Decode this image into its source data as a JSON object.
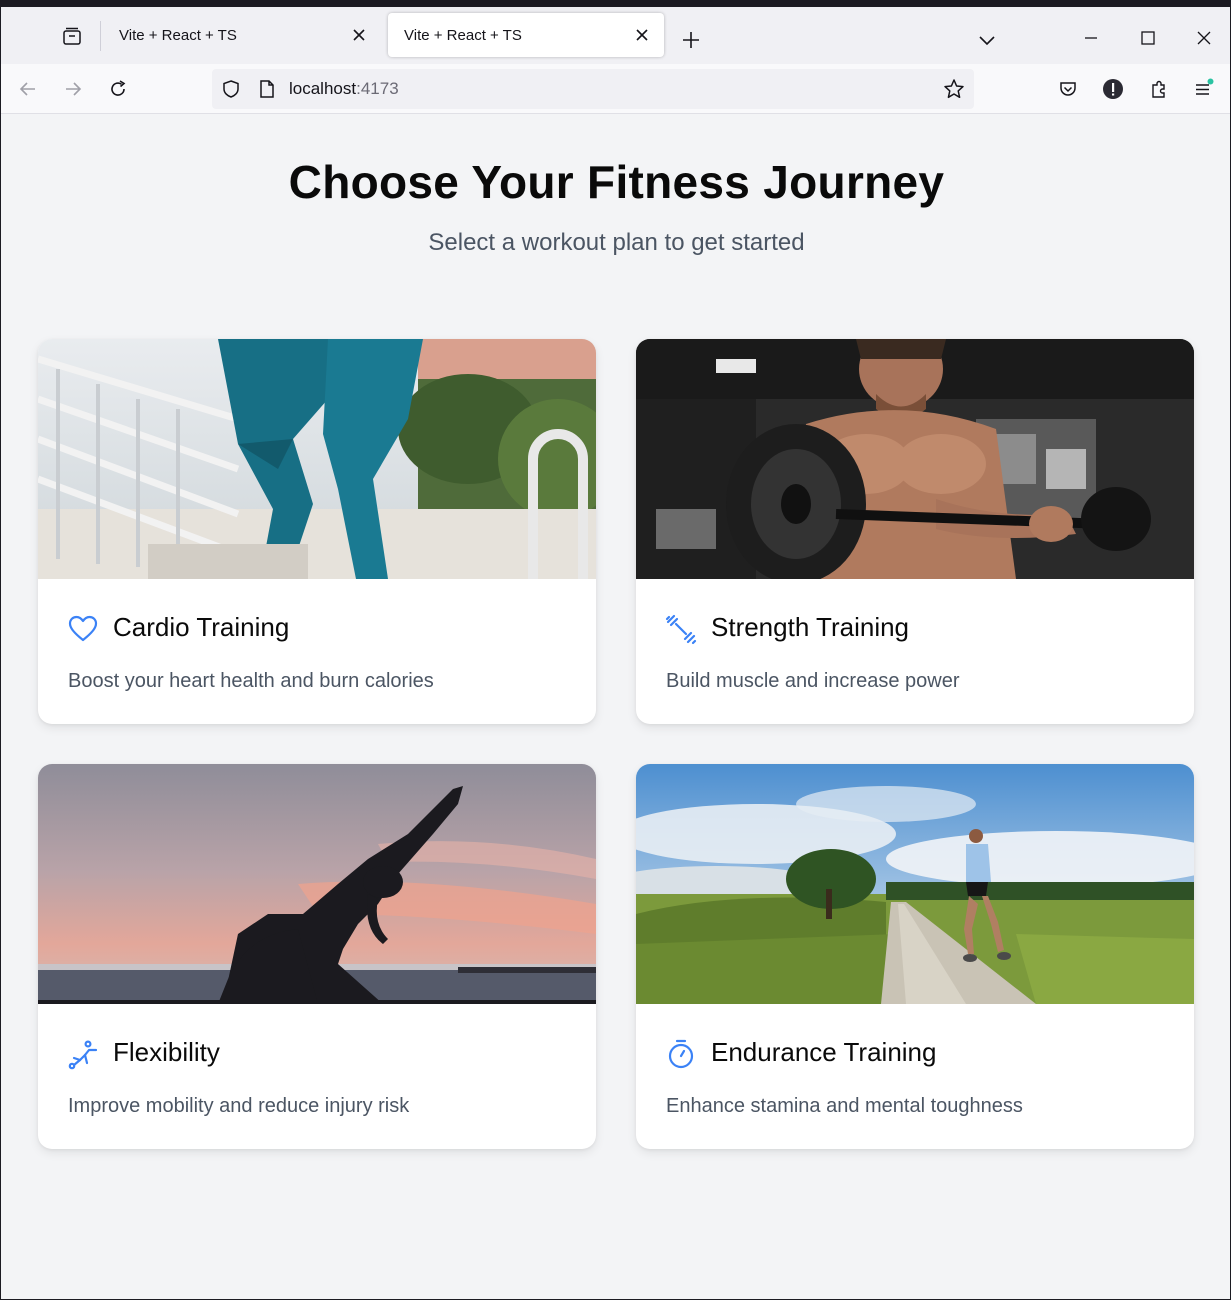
{
  "browser": {
    "tabs": [
      {
        "title": "Vite + React + TS",
        "active": false
      },
      {
        "title": "Vite + React + TS",
        "active": true
      }
    ],
    "url_host": "localhost",
    "url_port": ":4173",
    "icons": [
      "tab-overview-icon",
      "close-icon",
      "plus-icon",
      "chevron-down-icon",
      "minimize-icon",
      "maximize-icon",
      "back-icon",
      "forward-icon",
      "reload-icon",
      "shield-icon",
      "page-icon",
      "star-icon",
      "pocket-icon",
      "account-icon",
      "extensions-icon",
      "menu-icon"
    ]
  },
  "page": {
    "title": "Choose Your Fitness Journey",
    "subtitle": "Select a workout plan to get started"
  },
  "cards": [
    {
      "title": "Cardio Training",
      "description": "Boost your heart health and burn calories",
      "icon": "heart-icon",
      "photo": "legs-on-stairs"
    },
    {
      "title": "Strength Training",
      "description": "Build muscle and increase power",
      "icon": "dumbbell-icon",
      "photo": "man-lifting-barbell"
    },
    {
      "title": "Flexibility",
      "description": "Improve mobility and reduce injury risk",
      "icon": "stretch-icon",
      "photo": "yoga-silhouette-sunset"
    },
    {
      "title": "Endurance Training",
      "description": "Enhance stamina and mental toughness",
      "icon": "stopwatch-icon",
      "photo": "runner-on-trail"
    }
  ],
  "colors": {
    "accent": "#3b82f6",
    "text": "#0a0a0a",
    "muted": "#4b5563",
    "background": "#f3f4f6"
  }
}
